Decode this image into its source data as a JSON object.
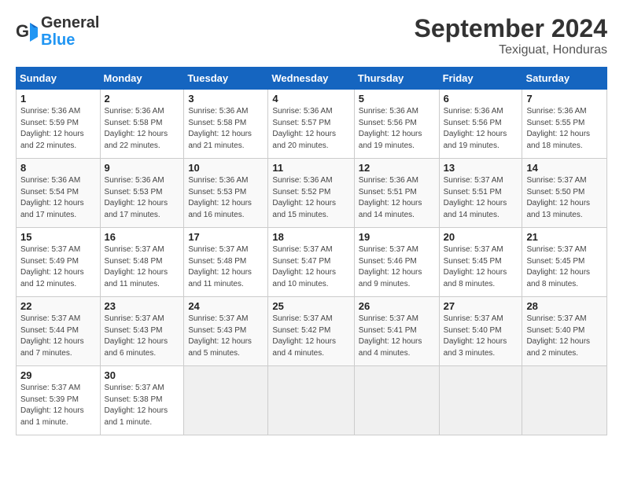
{
  "logo": {
    "text_general": "General",
    "text_blue": "Blue"
  },
  "header": {
    "month_title": "September 2024",
    "location": "Texiguat, Honduras"
  },
  "days_of_week": [
    "Sunday",
    "Monday",
    "Tuesday",
    "Wednesday",
    "Thursday",
    "Friday",
    "Saturday"
  ],
  "weeks": [
    [
      {
        "day": "1",
        "info": "Sunrise: 5:36 AM\nSunset: 5:59 PM\nDaylight: 12 hours\nand 22 minutes."
      },
      {
        "day": "2",
        "info": "Sunrise: 5:36 AM\nSunset: 5:58 PM\nDaylight: 12 hours\nand 22 minutes."
      },
      {
        "day": "3",
        "info": "Sunrise: 5:36 AM\nSunset: 5:58 PM\nDaylight: 12 hours\nand 21 minutes."
      },
      {
        "day": "4",
        "info": "Sunrise: 5:36 AM\nSunset: 5:57 PM\nDaylight: 12 hours\nand 20 minutes."
      },
      {
        "day": "5",
        "info": "Sunrise: 5:36 AM\nSunset: 5:56 PM\nDaylight: 12 hours\nand 19 minutes."
      },
      {
        "day": "6",
        "info": "Sunrise: 5:36 AM\nSunset: 5:56 PM\nDaylight: 12 hours\nand 19 minutes."
      },
      {
        "day": "7",
        "info": "Sunrise: 5:36 AM\nSunset: 5:55 PM\nDaylight: 12 hours\nand 18 minutes."
      }
    ],
    [
      {
        "day": "8",
        "info": "Sunrise: 5:36 AM\nSunset: 5:54 PM\nDaylight: 12 hours\nand 17 minutes."
      },
      {
        "day": "9",
        "info": "Sunrise: 5:36 AM\nSunset: 5:53 PM\nDaylight: 12 hours\nand 17 minutes."
      },
      {
        "day": "10",
        "info": "Sunrise: 5:36 AM\nSunset: 5:53 PM\nDaylight: 12 hours\nand 16 minutes."
      },
      {
        "day": "11",
        "info": "Sunrise: 5:36 AM\nSunset: 5:52 PM\nDaylight: 12 hours\nand 15 minutes."
      },
      {
        "day": "12",
        "info": "Sunrise: 5:36 AM\nSunset: 5:51 PM\nDaylight: 12 hours\nand 14 minutes."
      },
      {
        "day": "13",
        "info": "Sunrise: 5:37 AM\nSunset: 5:51 PM\nDaylight: 12 hours\nand 14 minutes."
      },
      {
        "day": "14",
        "info": "Sunrise: 5:37 AM\nSunset: 5:50 PM\nDaylight: 12 hours\nand 13 minutes."
      }
    ],
    [
      {
        "day": "15",
        "info": "Sunrise: 5:37 AM\nSunset: 5:49 PM\nDaylight: 12 hours\nand 12 minutes."
      },
      {
        "day": "16",
        "info": "Sunrise: 5:37 AM\nSunset: 5:48 PM\nDaylight: 12 hours\nand 11 minutes."
      },
      {
        "day": "17",
        "info": "Sunrise: 5:37 AM\nSunset: 5:48 PM\nDaylight: 12 hours\nand 11 minutes."
      },
      {
        "day": "18",
        "info": "Sunrise: 5:37 AM\nSunset: 5:47 PM\nDaylight: 12 hours\nand 10 minutes."
      },
      {
        "day": "19",
        "info": "Sunrise: 5:37 AM\nSunset: 5:46 PM\nDaylight: 12 hours\nand 9 minutes."
      },
      {
        "day": "20",
        "info": "Sunrise: 5:37 AM\nSunset: 5:45 PM\nDaylight: 12 hours\nand 8 minutes."
      },
      {
        "day": "21",
        "info": "Sunrise: 5:37 AM\nSunset: 5:45 PM\nDaylight: 12 hours\nand 8 minutes."
      }
    ],
    [
      {
        "day": "22",
        "info": "Sunrise: 5:37 AM\nSunset: 5:44 PM\nDaylight: 12 hours\nand 7 minutes."
      },
      {
        "day": "23",
        "info": "Sunrise: 5:37 AM\nSunset: 5:43 PM\nDaylight: 12 hours\nand 6 minutes."
      },
      {
        "day": "24",
        "info": "Sunrise: 5:37 AM\nSunset: 5:43 PM\nDaylight: 12 hours\nand 5 minutes."
      },
      {
        "day": "25",
        "info": "Sunrise: 5:37 AM\nSunset: 5:42 PM\nDaylight: 12 hours\nand 4 minutes."
      },
      {
        "day": "26",
        "info": "Sunrise: 5:37 AM\nSunset: 5:41 PM\nDaylight: 12 hours\nand 4 minutes."
      },
      {
        "day": "27",
        "info": "Sunrise: 5:37 AM\nSunset: 5:40 PM\nDaylight: 12 hours\nand 3 minutes."
      },
      {
        "day": "28",
        "info": "Sunrise: 5:37 AM\nSunset: 5:40 PM\nDaylight: 12 hours\nand 2 minutes."
      }
    ],
    [
      {
        "day": "29",
        "info": "Sunrise: 5:37 AM\nSunset: 5:39 PM\nDaylight: 12 hours\nand 1 minute."
      },
      {
        "day": "30",
        "info": "Sunrise: 5:37 AM\nSunset: 5:38 PM\nDaylight: 12 hours\nand 1 minute."
      },
      {
        "day": "",
        "info": ""
      },
      {
        "day": "",
        "info": ""
      },
      {
        "day": "",
        "info": ""
      },
      {
        "day": "",
        "info": ""
      },
      {
        "day": "",
        "info": ""
      }
    ]
  ]
}
